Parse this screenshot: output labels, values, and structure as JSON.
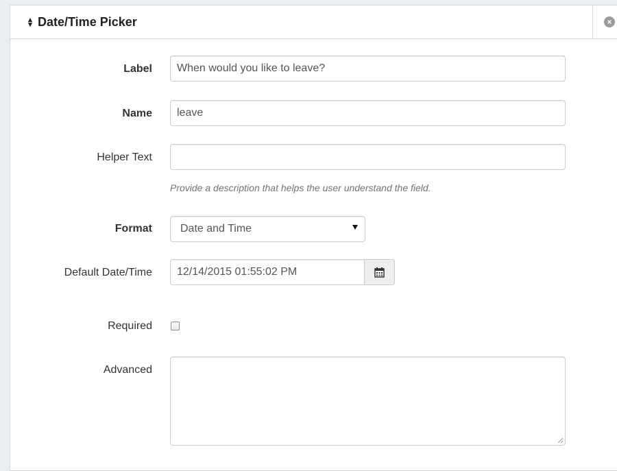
{
  "panel": {
    "title": "Date/Time Picker",
    "sort_icon": "sort-icon",
    "close_icon": "close-icon"
  },
  "form": {
    "label": {
      "label": "Label",
      "value": "When would you like to leave?"
    },
    "name": {
      "label": "Name",
      "value": "leave"
    },
    "helper_text": {
      "label": "Helper Text",
      "value": "",
      "hint": "Provide a description that helps the user understand the field."
    },
    "format": {
      "label": "Format",
      "selected": "Date and Time"
    },
    "default_datetime": {
      "label": "Default Date/Time",
      "value": "12/14/2015 01:55:02 PM",
      "icon": "calendar-icon"
    },
    "required": {
      "label": "Required",
      "checked": false
    },
    "advanced": {
      "label": "Advanced",
      "value": ""
    }
  },
  "colors": {
    "background": "#e9eef5",
    "panel": "#ffffff",
    "border": "#cccccc",
    "text": "#333333",
    "muted": "#737373"
  }
}
